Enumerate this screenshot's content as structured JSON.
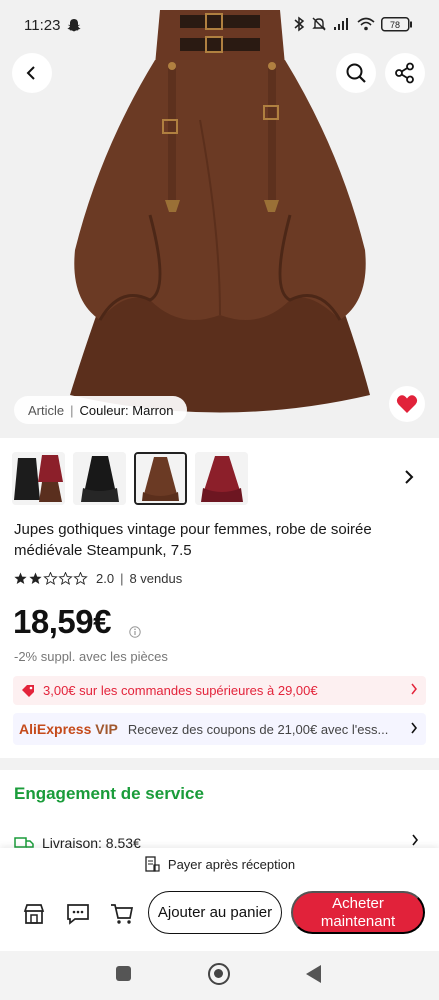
{
  "status_bar": {
    "time": "11:23",
    "battery": "78"
  },
  "hero": {
    "article_label": "Article",
    "color_label": "Couleur: Marron"
  },
  "thumbnails": [
    {
      "name": "thumb-black-red",
      "selected": false
    },
    {
      "name": "thumb-black",
      "selected": false
    },
    {
      "name": "thumb-brown",
      "selected": true
    },
    {
      "name": "thumb-red",
      "selected": false
    }
  ],
  "product": {
    "title": "Jupes gothiques vintage pour femmes, robe de soirée médiévale Steampunk, 7.5",
    "rating": "2.0",
    "rating_value": 2.0,
    "sold": "8 vendus",
    "price": "18,59€",
    "extra": "-2% suppl. avec les pièces"
  },
  "promo": {
    "text": "3,00€ sur les commandes supérieures à 29,00€"
  },
  "vip": {
    "brand_a": "AliExpress",
    "brand_b": "VIP",
    "text": "Recevez des coupons de 21,00€ avec l'ess..."
  },
  "service": {
    "title": "Engagement de service",
    "delivery": "Livraison: 8,53€"
  },
  "bottom": {
    "pay_after": "Payer après réception",
    "add_cart": "Ajouter au panier",
    "buy_now": "Acheter maintenant"
  },
  "colors": {
    "accent": "#e1223a",
    "green": "#1a9c3a",
    "skirt": "#6b3a24"
  }
}
